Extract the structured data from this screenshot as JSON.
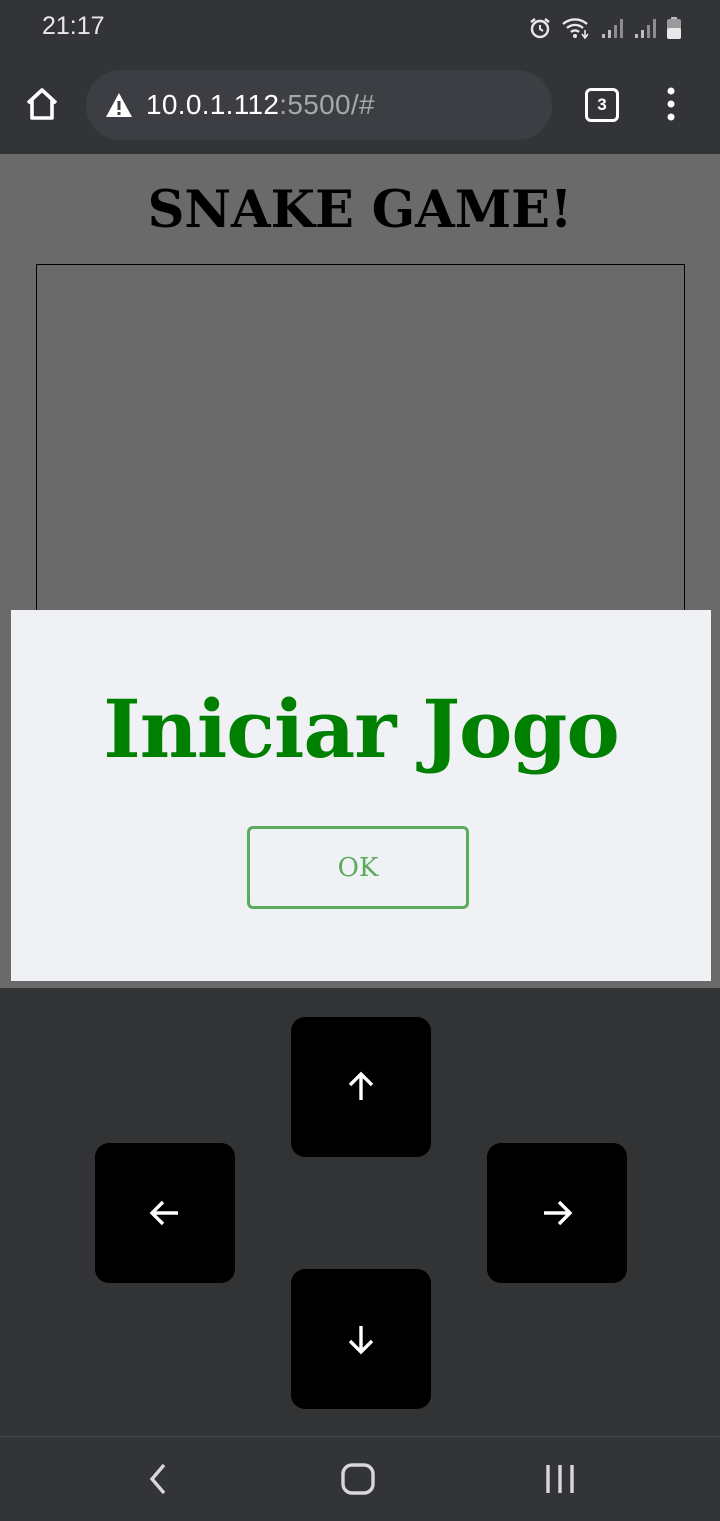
{
  "status": {
    "time": "21:17",
    "icons": [
      "alarm-icon",
      "wifi-icon",
      "signal-icon",
      "signal-icon",
      "battery-icon"
    ]
  },
  "browser": {
    "url_host": "10.0.1.112",
    "url_rest": ":5500/#",
    "tab_count": "3",
    "icons": [
      "home-icon",
      "warning-icon",
      "tabs-icon",
      "more-vert-icon"
    ]
  },
  "page": {
    "title": "SNAKE GAME!"
  },
  "modal": {
    "title": "Iniciar Jogo",
    "ok_label": "OK",
    "title_color": "#008000",
    "button_color": "#5caa5c"
  },
  "controls": {
    "buttons": [
      "arrow-up-icon",
      "arrow-left-icon",
      "arrow-right-icon",
      "arrow-down-icon"
    ]
  },
  "navbar": {
    "icons": [
      "back-icon",
      "home-nav-icon",
      "recents-icon"
    ]
  }
}
